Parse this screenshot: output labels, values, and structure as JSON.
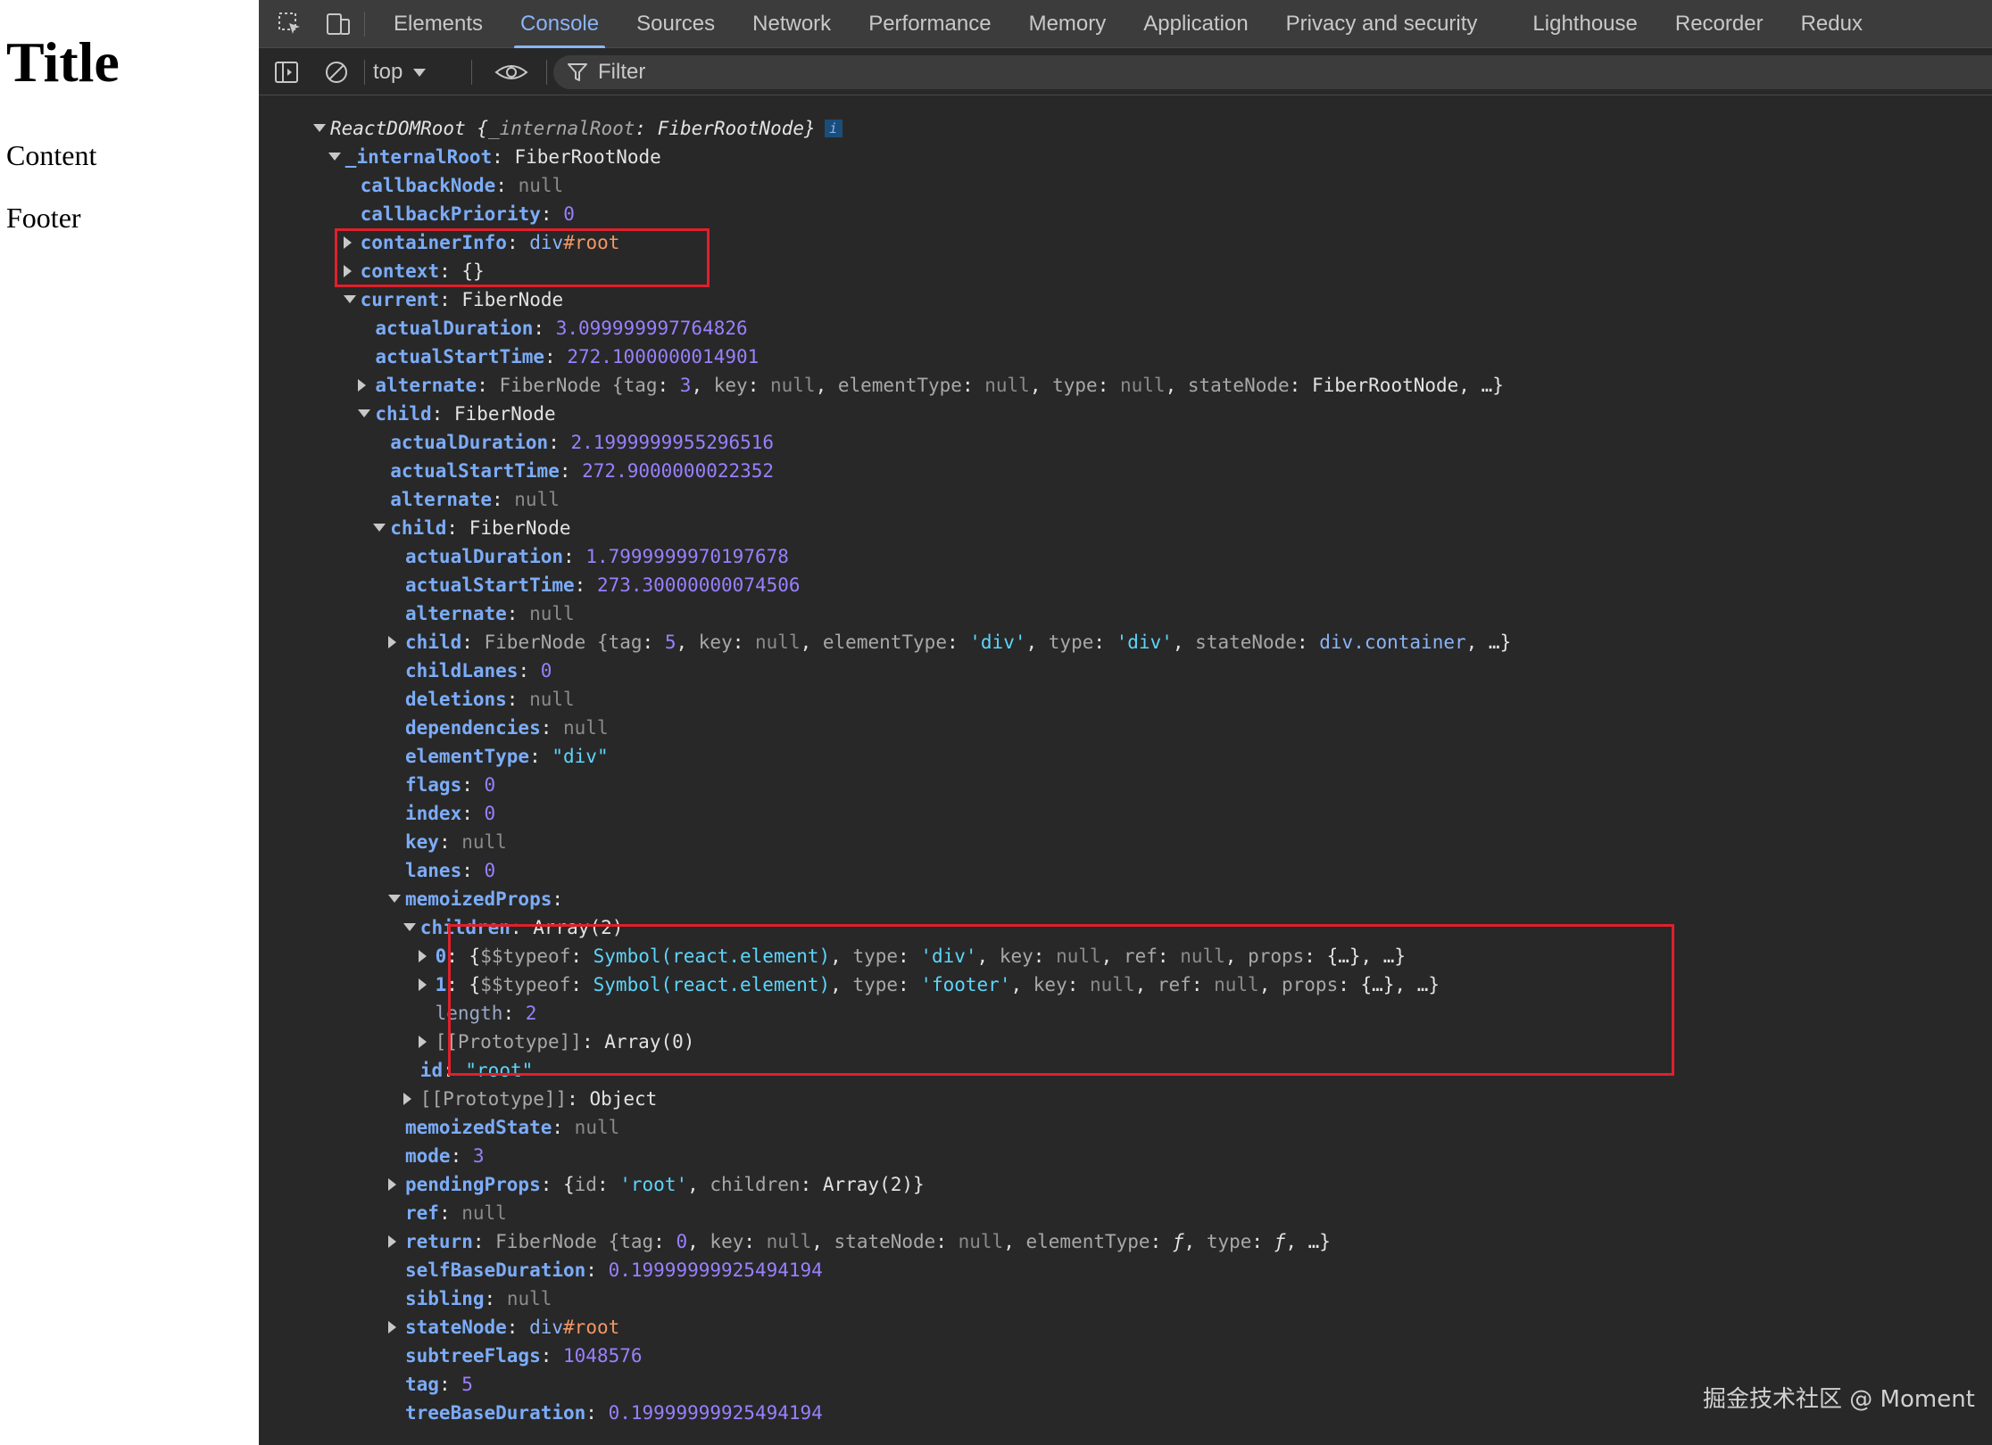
{
  "page": {
    "title": "Title",
    "content": "Content",
    "footer": "Footer"
  },
  "devtools": {
    "tabs": [
      {
        "label": "Elements"
      },
      {
        "label": "Console"
      },
      {
        "label": "Sources"
      },
      {
        "label": "Network"
      },
      {
        "label": "Performance"
      },
      {
        "label": "Memory"
      },
      {
        "label": "Application"
      },
      {
        "label": "Privacy and security"
      },
      {
        "label": "Lighthouse"
      },
      {
        "label": "Recorder"
      },
      {
        "label": "Redux"
      }
    ],
    "active_tab": "Console",
    "toolbar": {
      "context": "top",
      "filter_placeholder": "Filter"
    },
    "icons": {
      "inspect": "inspect-element-icon",
      "device": "device-toolbar-icon",
      "sidebar": "sidebar-toggle-icon",
      "clear": "clear-console-icon",
      "eye": "live-expression-eye-icon",
      "filter": "filter-funnel-icon"
    }
  },
  "console_lines": [
    {
      "indent": 0,
      "arrow": "down",
      "tokens": [
        [
          "ReactDOMRoot {",
          "t it"
        ],
        [
          "_internalRoot",
          "g it"
        ],
        [
          ": FiberRootNode}",
          "t it"
        ]
      ],
      "info": "i"
    },
    {
      "indent": 1,
      "arrow": "down",
      "tokens": [
        [
          "_internalRoot",
          "k"
        ],
        [
          ": FiberRootNode",
          "p"
        ]
      ]
    },
    {
      "indent": 2,
      "tokens": [
        [
          "callbackNode",
          "k"
        ],
        [
          ": ",
          "p"
        ],
        [
          "null",
          "nl"
        ]
      ]
    },
    {
      "indent": 2,
      "tokens": [
        [
          "callbackPriority",
          "k"
        ],
        [
          ": ",
          "p"
        ],
        [
          "0",
          "n"
        ]
      ]
    },
    {
      "indent": 2,
      "arrow": "right",
      "tokens": [
        [
          "containerInfo",
          "k"
        ],
        [
          ": ",
          "p"
        ],
        [
          "div",
          "tag"
        ],
        [
          "#root",
          "id"
        ]
      ]
    },
    {
      "indent": 2,
      "arrow": "right",
      "tokens": [
        [
          "context",
          "k"
        ],
        [
          ": {}",
          "p"
        ]
      ]
    },
    {
      "indent": 2,
      "arrow": "down",
      "tokens": [
        [
          "current",
          "k"
        ],
        [
          ": FiberNode",
          "p"
        ]
      ]
    },
    {
      "indent": 3,
      "tokens": [
        [
          "actualDuration",
          "k"
        ],
        [
          ": ",
          "p"
        ],
        [
          "3.099999997764826",
          "n"
        ]
      ]
    },
    {
      "indent": 3,
      "tokens": [
        [
          "actualStartTime",
          "k"
        ],
        [
          ": ",
          "p"
        ],
        [
          "272.1000000014901",
          "n"
        ]
      ]
    },
    {
      "indent": 3,
      "arrow": "right",
      "tokens": [
        [
          "alternate",
          "k"
        ],
        [
          ": ",
          "p"
        ],
        [
          "FiberNode {",
          "g"
        ],
        [
          "tag",
          "g"
        ],
        [
          ": ",
          "p"
        ],
        [
          "3",
          "n"
        ],
        [
          ", ",
          "p"
        ],
        [
          "key",
          "g"
        ],
        [
          ": ",
          "p"
        ],
        [
          "null",
          "nl"
        ],
        [
          ", ",
          "p"
        ],
        [
          "elementType",
          "g"
        ],
        [
          ": ",
          "p"
        ],
        [
          "null",
          "nl"
        ],
        [
          ", ",
          "p"
        ],
        [
          "type",
          "g"
        ],
        [
          ": ",
          "p"
        ],
        [
          "null",
          "nl"
        ],
        [
          ", ",
          "p"
        ],
        [
          "stateNode",
          "g"
        ],
        [
          ": FiberRootNode, …}",
          "p"
        ]
      ]
    },
    {
      "indent": 3,
      "arrow": "down",
      "tokens": [
        [
          "child",
          "k"
        ],
        [
          ": FiberNode",
          "p"
        ]
      ]
    },
    {
      "indent": 4,
      "tokens": [
        [
          "actualDuration",
          "k"
        ],
        [
          ": ",
          "p"
        ],
        [
          "2.1999999955296516",
          "n"
        ]
      ]
    },
    {
      "indent": 4,
      "tokens": [
        [
          "actualStartTime",
          "k"
        ],
        [
          ": ",
          "p"
        ],
        [
          "272.9000000022352",
          "n"
        ]
      ]
    },
    {
      "indent": 4,
      "tokens": [
        [
          "alternate",
          "k"
        ],
        [
          ": ",
          "p"
        ],
        [
          "null",
          "nl"
        ]
      ]
    },
    {
      "indent": 4,
      "arrow": "down",
      "tokens": [
        [
          "child",
          "k"
        ],
        [
          ": FiberNode",
          "p"
        ]
      ]
    },
    {
      "indent": 5,
      "tokens": [
        [
          "actualDuration",
          "k"
        ],
        [
          ": ",
          "p"
        ],
        [
          "1.7999999970197678",
          "n"
        ]
      ]
    },
    {
      "indent": 5,
      "tokens": [
        [
          "actualStartTime",
          "k"
        ],
        [
          ": ",
          "p"
        ],
        [
          "273.30000000074506",
          "n"
        ]
      ]
    },
    {
      "indent": 5,
      "tokens": [
        [
          "alternate",
          "k"
        ],
        [
          ": ",
          "p"
        ],
        [
          "null",
          "nl"
        ]
      ]
    },
    {
      "indent": 5,
      "arrow": "right",
      "tokens": [
        [
          "child",
          "k"
        ],
        [
          ": ",
          "p"
        ],
        [
          "FiberNode {",
          "g"
        ],
        [
          "tag",
          "g"
        ],
        [
          ": ",
          "p"
        ],
        [
          "5",
          "n"
        ],
        [
          ", ",
          "p"
        ],
        [
          "key",
          "g"
        ],
        [
          ": ",
          "p"
        ],
        [
          "null",
          "nl"
        ],
        [
          ", ",
          "p"
        ],
        [
          "elementType",
          "g"
        ],
        [
          ": ",
          "p"
        ],
        [
          "'div'",
          "st"
        ],
        [
          ", ",
          "p"
        ],
        [
          "type",
          "g"
        ],
        [
          ": ",
          "p"
        ],
        [
          "'div'",
          "st"
        ],
        [
          ", ",
          "p"
        ],
        [
          "stateNode",
          "g"
        ],
        [
          ": ",
          "p"
        ],
        [
          "div.container",
          "tag"
        ],
        [
          ", …}",
          "p"
        ]
      ]
    },
    {
      "indent": 5,
      "tokens": [
        [
          "childLanes",
          "k"
        ],
        [
          ": ",
          "p"
        ],
        [
          "0",
          "n"
        ]
      ]
    },
    {
      "indent": 5,
      "tokens": [
        [
          "deletions",
          "k"
        ],
        [
          ": ",
          "p"
        ],
        [
          "null",
          "nl"
        ]
      ]
    },
    {
      "indent": 5,
      "tokens": [
        [
          "dependencies",
          "k"
        ],
        [
          ": ",
          "p"
        ],
        [
          "null",
          "nl"
        ]
      ]
    },
    {
      "indent": 5,
      "tokens": [
        [
          "elementType",
          "k"
        ],
        [
          ": ",
          "p"
        ],
        [
          "\"div\"",
          "st"
        ]
      ]
    },
    {
      "indent": 5,
      "tokens": [
        [
          "flags",
          "k"
        ],
        [
          ": ",
          "p"
        ],
        [
          "0",
          "n"
        ]
      ]
    },
    {
      "indent": 5,
      "tokens": [
        [
          "index",
          "k"
        ],
        [
          ": ",
          "p"
        ],
        [
          "0",
          "n"
        ]
      ]
    },
    {
      "indent": 5,
      "tokens": [
        [
          "key",
          "k"
        ],
        [
          ": ",
          "p"
        ],
        [
          "null",
          "nl"
        ]
      ]
    },
    {
      "indent": 5,
      "tokens": [
        [
          "lanes",
          "k"
        ],
        [
          ": ",
          "p"
        ],
        [
          "0",
          "n"
        ]
      ]
    },
    {
      "indent": 5,
      "arrow": "down",
      "tokens": [
        [
          "memoizedProps",
          "k"
        ],
        [
          ":",
          "p"
        ]
      ]
    },
    {
      "indent": 6,
      "arrow": "down",
      "tokens": [
        [
          "children",
          "k"
        ],
        [
          ": Array(2)",
          "p"
        ]
      ]
    },
    {
      "indent": 7,
      "arrow": "right",
      "tokens": [
        [
          "0",
          "k"
        ],
        [
          ": {",
          "p"
        ],
        [
          "$$typeof",
          "g"
        ],
        [
          ": ",
          "p"
        ],
        [
          "Symbol(react.element)",
          "s"
        ],
        [
          ", ",
          "p"
        ],
        [
          "type",
          "g"
        ],
        [
          ": ",
          "p"
        ],
        [
          "'div'",
          "st"
        ],
        [
          ", ",
          "p"
        ],
        [
          "key",
          "g"
        ],
        [
          ": ",
          "p"
        ],
        [
          "null",
          "nl"
        ],
        [
          ", ",
          "p"
        ],
        [
          "ref",
          "g"
        ],
        [
          ": ",
          "p"
        ],
        [
          "null",
          "nl"
        ],
        [
          ", ",
          "p"
        ],
        [
          "props",
          "g"
        ],
        [
          ": {…}, …}",
          "p"
        ]
      ]
    },
    {
      "indent": 7,
      "arrow": "right",
      "tokens": [
        [
          "1",
          "k"
        ],
        [
          ": {",
          "p"
        ],
        [
          "$$typeof",
          "g"
        ],
        [
          ": ",
          "p"
        ],
        [
          "Symbol(react.element)",
          "s"
        ],
        [
          ", ",
          "p"
        ],
        [
          "type",
          "g"
        ],
        [
          ": ",
          "p"
        ],
        [
          "'footer'",
          "st"
        ],
        [
          ", ",
          "p"
        ],
        [
          "key",
          "g"
        ],
        [
          ": ",
          "p"
        ],
        [
          "null",
          "nl"
        ],
        [
          ", ",
          "p"
        ],
        [
          "ref",
          "g"
        ],
        [
          ": ",
          "p"
        ],
        [
          "null",
          "nl"
        ],
        [
          ", ",
          "p"
        ],
        [
          "props",
          "g"
        ],
        [
          ": {…}, …}",
          "p"
        ]
      ]
    },
    {
      "indent": 7,
      "tokens": [
        [
          "length",
          "kd"
        ],
        [
          ": ",
          "p"
        ],
        [
          "2",
          "n"
        ]
      ]
    },
    {
      "indent": 7,
      "arrow": "right",
      "tokens": [
        [
          "[[Prototype]]",
          "g"
        ],
        [
          ": Array(0)",
          "p"
        ]
      ]
    },
    {
      "indent": 6,
      "tokens": [
        [
          "id",
          "k"
        ],
        [
          ": ",
          "p"
        ],
        [
          "\"root\"",
          "st"
        ]
      ]
    },
    {
      "indent": 6,
      "arrow": "right",
      "tokens": [
        [
          "[[Prototype]]",
          "g"
        ],
        [
          ": Object",
          "p"
        ]
      ]
    },
    {
      "indent": 5,
      "tokens": [
        [
          "memoizedState",
          "k"
        ],
        [
          ": ",
          "p"
        ],
        [
          "null",
          "nl"
        ]
      ]
    },
    {
      "indent": 5,
      "tokens": [
        [
          "mode",
          "k"
        ],
        [
          ": ",
          "p"
        ],
        [
          "3",
          "n"
        ]
      ]
    },
    {
      "indent": 5,
      "arrow": "right",
      "tokens": [
        [
          "pendingProps",
          "k"
        ],
        [
          ": {",
          "p"
        ],
        [
          "id",
          "g"
        ],
        [
          ": ",
          "p"
        ],
        [
          "'root'",
          "st"
        ],
        [
          ", ",
          "p"
        ],
        [
          "children",
          "g"
        ],
        [
          ": Array(2)}",
          "p"
        ]
      ]
    },
    {
      "indent": 5,
      "tokens": [
        [
          "ref",
          "k"
        ],
        [
          ": ",
          "p"
        ],
        [
          "null",
          "nl"
        ]
      ]
    },
    {
      "indent": 5,
      "arrow": "right",
      "tokens": [
        [
          "return",
          "k"
        ],
        [
          ": ",
          "p"
        ],
        [
          "FiberNode {",
          "g"
        ],
        [
          "tag",
          "g"
        ],
        [
          ": ",
          "p"
        ],
        [
          "0",
          "n"
        ],
        [
          ", ",
          "p"
        ],
        [
          "key",
          "g"
        ],
        [
          ": ",
          "p"
        ],
        [
          "null",
          "nl"
        ],
        [
          ", ",
          "p"
        ],
        [
          "stateNode",
          "g"
        ],
        [
          ": ",
          "p"
        ],
        [
          "null",
          "nl"
        ],
        [
          ", ",
          "p"
        ],
        [
          "elementType",
          "g"
        ],
        [
          ": ",
          "p"
        ],
        [
          "ƒ",
          "p it"
        ],
        [
          ", ",
          "p"
        ],
        [
          "type",
          "g"
        ],
        [
          ": ",
          "p"
        ],
        [
          "ƒ",
          "p it"
        ],
        [
          ", …}",
          "p"
        ]
      ]
    },
    {
      "indent": 5,
      "tokens": [
        [
          "selfBaseDuration",
          "k"
        ],
        [
          ": ",
          "p"
        ],
        [
          "0.19999999925494194",
          "n"
        ]
      ]
    },
    {
      "indent": 5,
      "tokens": [
        [
          "sibling",
          "k"
        ],
        [
          ": ",
          "p"
        ],
        [
          "null",
          "nl"
        ]
      ]
    },
    {
      "indent": 5,
      "arrow": "right",
      "tokens": [
        [
          "stateNode",
          "k"
        ],
        [
          ": ",
          "p"
        ],
        [
          "div",
          "tag"
        ],
        [
          "#root",
          "id"
        ]
      ]
    },
    {
      "indent": 5,
      "tokens": [
        [
          "subtreeFlags",
          "k"
        ],
        [
          ": ",
          "p"
        ],
        [
          "1048576",
          "n"
        ]
      ]
    },
    {
      "indent": 5,
      "tokens": [
        [
          "tag",
          "k"
        ],
        [
          ": ",
          "p"
        ],
        [
          "5",
          "n"
        ]
      ]
    },
    {
      "indent": 5,
      "tokens": [
        [
          "treeBaseDuration",
          "k"
        ],
        [
          ": ",
          "p"
        ],
        [
          "0.19999999925494194",
          "n"
        ]
      ]
    }
  ],
  "watermark": "掘金技术社区 @ Moment"
}
